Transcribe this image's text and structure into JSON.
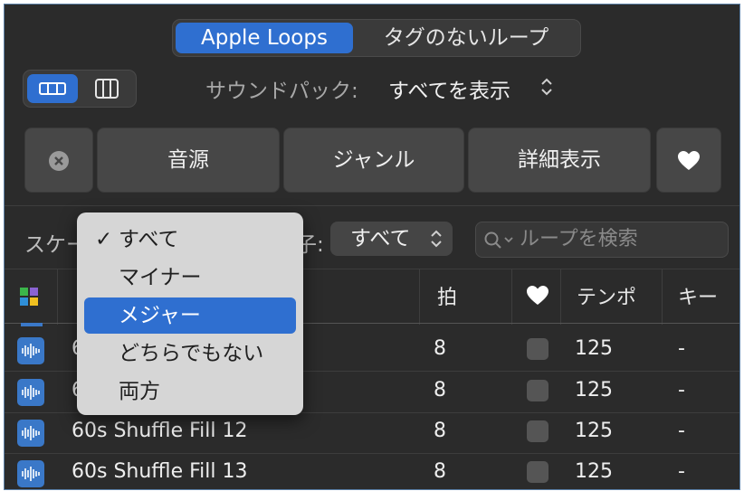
{
  "tabs": {
    "apple_loops": "Apple Loops",
    "untagged_loops": "タグのないループ"
  },
  "sound_pack": {
    "label": "サウンドパック:",
    "value": "すべてを表示"
  },
  "filter_buttons": {
    "instrument": "音源",
    "genre": "ジャンル",
    "descriptors": "詳細表示"
  },
  "scale_row": {
    "scale_label_partial": "スケー",
    "signature_label_partial": "子:",
    "signature_value": "すべて",
    "search_placeholder": "ループを検索"
  },
  "columns": {
    "beats": "拍",
    "tempo": "テンポ",
    "key": "キー"
  },
  "rows": [
    {
      "name": "6",
      "beats": "8",
      "tempo": "125",
      "key": "-"
    },
    {
      "name": "6",
      "beats": "8",
      "tempo": "125",
      "key": "-"
    },
    {
      "name": "60s Shuffle Fill 12",
      "beats": "8",
      "tempo": "125",
      "key": "-"
    },
    {
      "name": "60s Shuffle Fill 13",
      "beats": "8",
      "tempo": "125",
      "key": "-"
    }
  ],
  "scale_menu": {
    "items": [
      "すべて",
      "マイナー",
      "メジャー",
      "どちらでもない",
      "両方"
    ],
    "checked_index": 0,
    "highlighted_index": 2,
    "check_glyph": "✓"
  },
  "colors": {
    "accent": "#2f6fd0",
    "background": "#2b2b2b",
    "menu": "#d6d6d6"
  }
}
